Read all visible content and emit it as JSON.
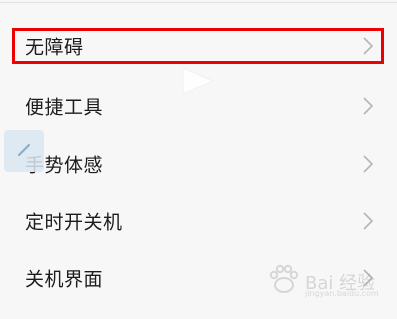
{
  "settings": {
    "items": [
      {
        "label": "无障碍",
        "icon": "chevron-right-icon"
      },
      {
        "label": "便捷工具",
        "icon": "chevron-right-icon"
      },
      {
        "label": "手势体感",
        "icon": "chevron-right-icon"
      },
      {
        "label": "定时开关机",
        "icon": "chevron-right-icon"
      },
      {
        "label": "关机界面",
        "icon": "chevron-right-icon"
      }
    ]
  },
  "highlight": {
    "color": "#ee0000",
    "target": "无障碍"
  },
  "watermark": {
    "text": "Bai 经验",
    "url": "jingyan.baidu.com"
  },
  "colors": {
    "background": "#f7f7f7",
    "text": "#1c1c1c",
    "chevron": "#b5b5b5"
  }
}
